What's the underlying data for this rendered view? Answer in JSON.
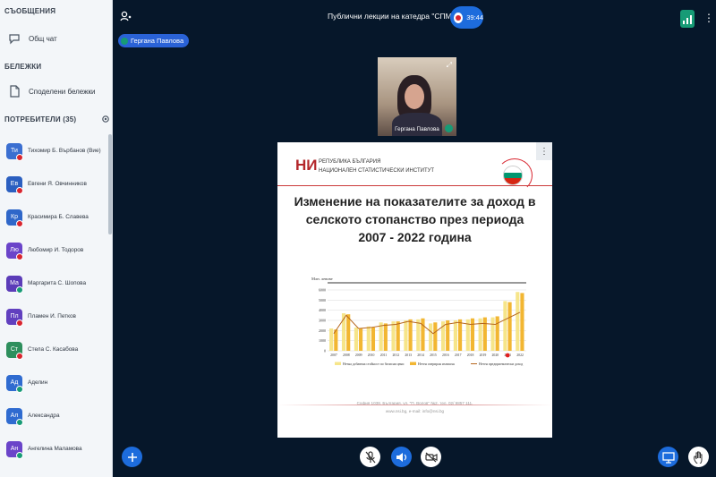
{
  "sidebar": {
    "messages_title": "СЪОБЩЕНИЯ",
    "public_chat_label": "Общ чат",
    "notes_title": "БЕЛЕЖКИ",
    "shared_notes_label": "Споделени бележки",
    "users_title": "ПОТРЕБИТЕЛИ (35)",
    "users": [
      {
        "initials": "Ти",
        "name": "Тихомир Б. Върбанов (Вие)",
        "color": "#3b6fd1",
        "status": "red"
      },
      {
        "initials": "Ев",
        "name": "Евгени Я. Овчинников",
        "color": "#2b5fc0",
        "status": "red"
      },
      {
        "initials": "Кр",
        "name": "Красимира Б. Славева",
        "color": "#2f67c9",
        "status": "red"
      },
      {
        "initials": "Лю",
        "name": "Любомир И. Тодоров",
        "color": "#6a44c9",
        "status": "red"
      },
      {
        "initials": "Ма",
        "name": "Маргарита С. Шопова",
        "color": "#5b3cb8",
        "status": "green"
      },
      {
        "initials": "Пл",
        "name": "Пламен И. Петков",
        "color": "#6140bf",
        "status": "red"
      },
      {
        "initials": "Ст",
        "name": "Стела С. Касабова",
        "color": "#2e8f5d",
        "status": "red"
      },
      {
        "initials": "Ад",
        "name": "Аделин",
        "color": "#2f6bd0",
        "status": "green"
      },
      {
        "initials": "Ал",
        "name": "Александра",
        "color": "#2f6bd0",
        "status": "green"
      },
      {
        "initials": "Ан",
        "name": "Ангелина Маламова",
        "color": "#6a44c9",
        "status": "green"
      }
    ]
  },
  "header": {
    "title": "Публични лекции на катедра \"СПМ\"",
    "recording_time": "39:44"
  },
  "presenter": {
    "tag_name": "Гергана Павлова",
    "webcam_label": "Гергана Павлова"
  },
  "slide": {
    "logo_letters": "НИ",
    "logo_line1": "РЕПУБЛИКА БЪЛГАРИЯ",
    "logo_line2": "НАЦИОНАЛЕН СТАТИСТИЧЕСКИ ИНСТИТУТ",
    "title_line1": "Изменение на показателите за доход в",
    "title_line2": "селското стопанство през периода",
    "title_line3": "2007 - 2022 година",
    "footer_line1": "София 1038, България, ул. \"П. Волов\" №2, тел. 02/ 9857 111,",
    "footer_line2": "www.nsi.bg, e-mail: info@nsi.bg"
  },
  "chart_data": {
    "type": "bar",
    "ylabel": "Млн. левове",
    "ylim": [
      0,
      6000
    ],
    "yticks": [
      0,
      1000,
      2000,
      3000,
      4000,
      5000,
      6000
    ],
    "categories": [
      "2007",
      "2008",
      "2009",
      "2010",
      "2011",
      "2012",
      "2013",
      "2014",
      "2015",
      "2016",
      "2017",
      "2018",
      "2019",
      "2020",
      "2021",
      "2022"
    ],
    "series": [
      {
        "name": "Нетна добавена стойност по базисни цени",
        "kind": "bar",
        "color": "#f6e58a",
        "values": [
          2200,
          3700,
          2300,
          2400,
          2800,
          2900,
          3000,
          3100,
          2700,
          2900,
          3000,
          3100,
          3200,
          3300,
          4900,
          5800
        ]
      },
      {
        "name": "Нетен опериран излишък",
        "kind": "bar",
        "color": "#f2b632",
        "values": [
          2100,
          3600,
          2200,
          2300,
          2700,
          2900,
          3100,
          3200,
          2800,
          3000,
          3100,
          3200,
          3300,
          3400,
          4800,
          5700
        ]
      },
      {
        "name": "Нетен предприемачески доход",
        "kind": "line",
        "color": "#b5651d",
        "values": [
          1700,
          3500,
          2200,
          2300,
          2500,
          2600,
          2900,
          2700,
          1700,
          2600,
          2800,
          2600,
          2700,
          2600,
          3200,
          3800
        ]
      }
    ],
    "grid": true,
    "legend_position": "bottom"
  }
}
